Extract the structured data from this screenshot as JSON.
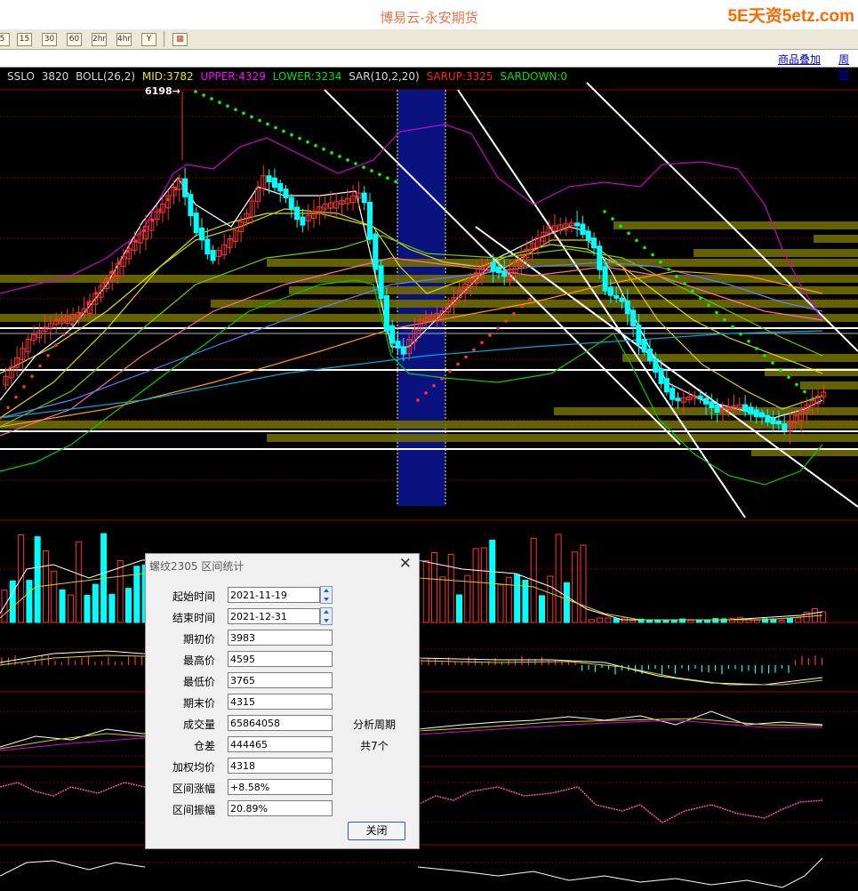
{
  "window": {
    "title": "博易云-永安期货",
    "brand": "5E天资5etz.com"
  },
  "toolbar": {
    "buttons": [
      "5",
      "15",
      "30",
      "60",
      "2hr",
      "4hr",
      "Y"
    ]
  },
  "linkbar": {
    "overlay_link": "商品叠加",
    "period_link": "周期"
  },
  "indicator": {
    "symbol": "SSLO",
    "price": "3820",
    "boll": "BOLL(26,2)",
    "mid": "MID:3782",
    "upper": "UPPER:4329",
    "lower": "LOWER:3234",
    "sar": "SAR(10,2,20)",
    "sarup": "SARUP:3325",
    "sardown": "SARDOWN:0"
  },
  "chart": {
    "peak_label": "6198→",
    "colors": {
      "up_candle": "#ff3333",
      "down_candle": "#00ffff",
      "mid": "#ffff00",
      "upper": "#ff00ff",
      "lower": "#00ff00",
      "sar": "#00ff00",
      "volume_box": "#8c8a00",
      "selection": "#0a1280"
    }
  },
  "dialog": {
    "title": "螺纹2305 区间统计",
    "close_icon": "close-icon",
    "start_label": "起始时间",
    "start_value": "2021-11-19",
    "end_label": "结束时间",
    "end_value": "2021-12-31",
    "open_label": "期初价",
    "open_value": "3983",
    "high_label": "最高价",
    "high_value": "4595",
    "low_label": "最低价",
    "low_value": "3765",
    "close_label": "期末价",
    "close_value": "4315",
    "volume_label": "成交量",
    "volume_value": "65864058",
    "oi_label": "仓差",
    "oi_value": "444465",
    "vwap_label": "加权均价",
    "vwap_value": "4318",
    "change_label": "区间涨幅",
    "change_value": "+8.58%",
    "amp_label": "区间振幅",
    "amp_value": "20.89%",
    "period_label": "分析周期",
    "period_value": "共7个",
    "close_button": "关闭"
  }
}
